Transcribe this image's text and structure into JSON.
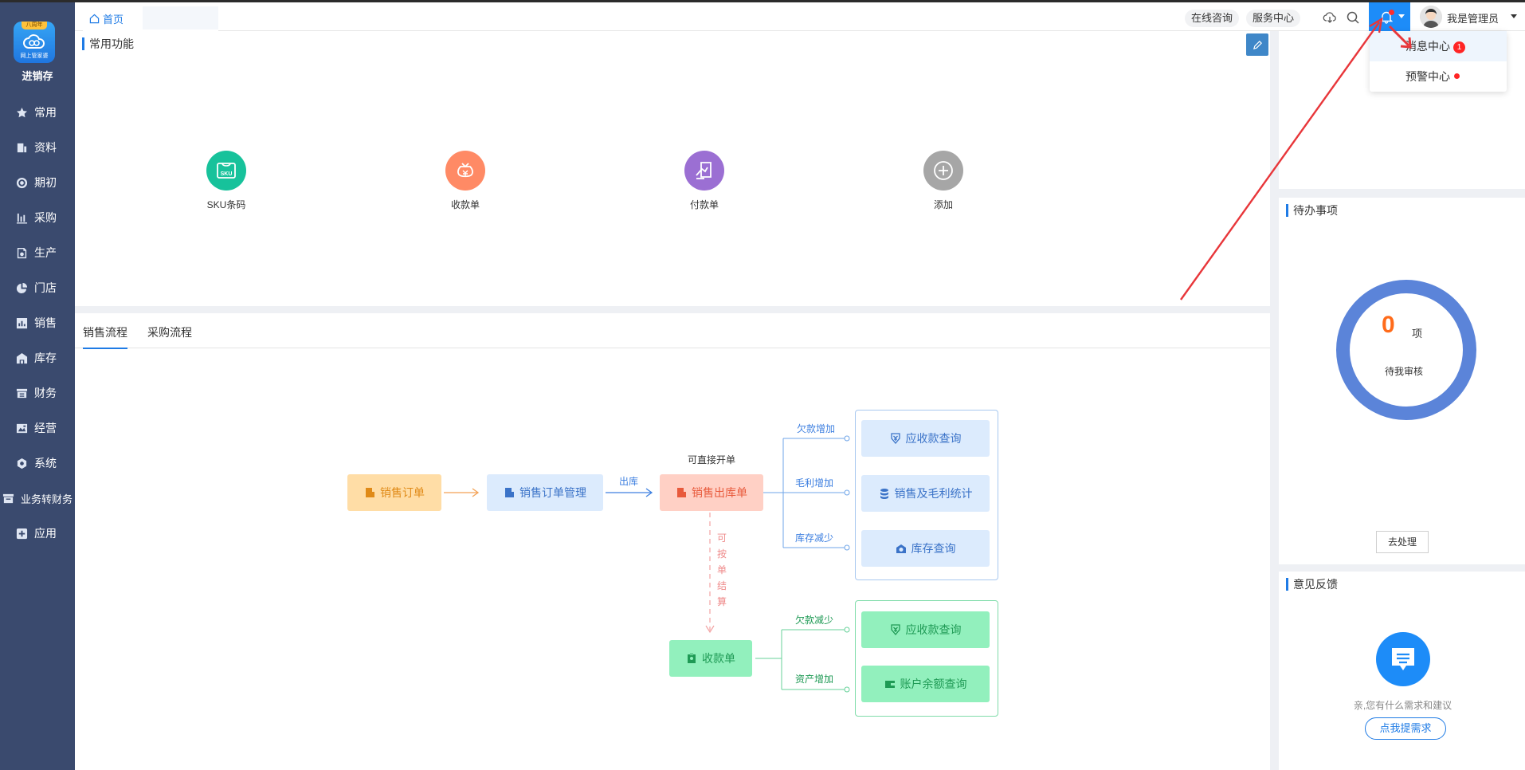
{
  "sidebar": {
    "logo_tag": "八周年",
    "logo_text": "网上管家婆",
    "app_name": "进销存",
    "items": [
      {
        "label": "常用",
        "icon": "star-icon"
      },
      {
        "label": "资料",
        "icon": "document-icon"
      },
      {
        "label": "期初",
        "icon": "target-icon"
      },
      {
        "label": "采购",
        "icon": "bar-chart-icon"
      },
      {
        "label": "生产",
        "icon": "factory-icon"
      },
      {
        "label": "门店",
        "icon": "pie-chart-icon"
      },
      {
        "label": "销售",
        "icon": "sales-chart-icon"
      },
      {
        "label": "库存",
        "icon": "warehouse-icon"
      },
      {
        "label": "财务",
        "icon": "finance-icon"
      },
      {
        "label": "经营",
        "icon": "business-icon"
      },
      {
        "label": "系统",
        "icon": "gear-icon"
      },
      {
        "label": "业务转财务",
        "icon": "transfer-icon"
      },
      {
        "label": "应用",
        "icon": "plus-square-icon"
      }
    ]
  },
  "header": {
    "home_tab": "首页",
    "online_consult": "在线咨询",
    "service_center": "服务中心",
    "user_name": "我是管理员"
  },
  "dropdown": {
    "message_center": "消息中心",
    "message_count": "1",
    "alert_center": "预警中心"
  },
  "common_functions": {
    "title": "常用功能",
    "items": [
      {
        "label": "SKU条码",
        "color": "#17c29b",
        "icon": "sku-icon"
      },
      {
        "label": "收款单",
        "color": "#ff8a65",
        "icon": "receipt-icon"
      },
      {
        "label": "付款单",
        "color": "#9b6fd3",
        "icon": "payment-icon"
      },
      {
        "label": "添加",
        "color": "#a6a6a6",
        "icon": "add-circle-icon"
      }
    ]
  },
  "flow_tabs": [
    "销售流程",
    "采购流程"
  ],
  "flow": {
    "sales_order": "销售订单",
    "sales_order_mgmt": "销售订单管理",
    "ship_label": "出库",
    "direct_label": "可直接开单",
    "sales_outbound": "销售出库单",
    "settle_label": [
      "可",
      "按",
      "单",
      "结",
      "算"
    ],
    "receipt": "收款单",
    "branch_debt_up": "欠款增加",
    "branch_profit_up": "毛利增加",
    "branch_stock_down": "库存减少",
    "branch_debt_down": "欠款减少",
    "branch_asset_up": "资产增加",
    "receivable_query": "应收款查询",
    "sales_profit_stats": "销售及毛利统计",
    "stock_query": "库存查询",
    "receivable_query_2": "应收款查询",
    "account_balance_query": "账户余额查询"
  },
  "todo": {
    "title": "待办事项",
    "count": "0",
    "unit": "项",
    "label": "待我审核",
    "button": "去处理"
  },
  "feedback": {
    "title": "意见反馈",
    "text": "亲,您有什么需求和建议",
    "button": "点我提需求"
  },
  "colors": {
    "sidebar": "#3a4a6e",
    "accent": "#1f7be5",
    "ring": "#5b84d9",
    "count": "#ff6b1a",
    "arrow": "#e8363a"
  }
}
